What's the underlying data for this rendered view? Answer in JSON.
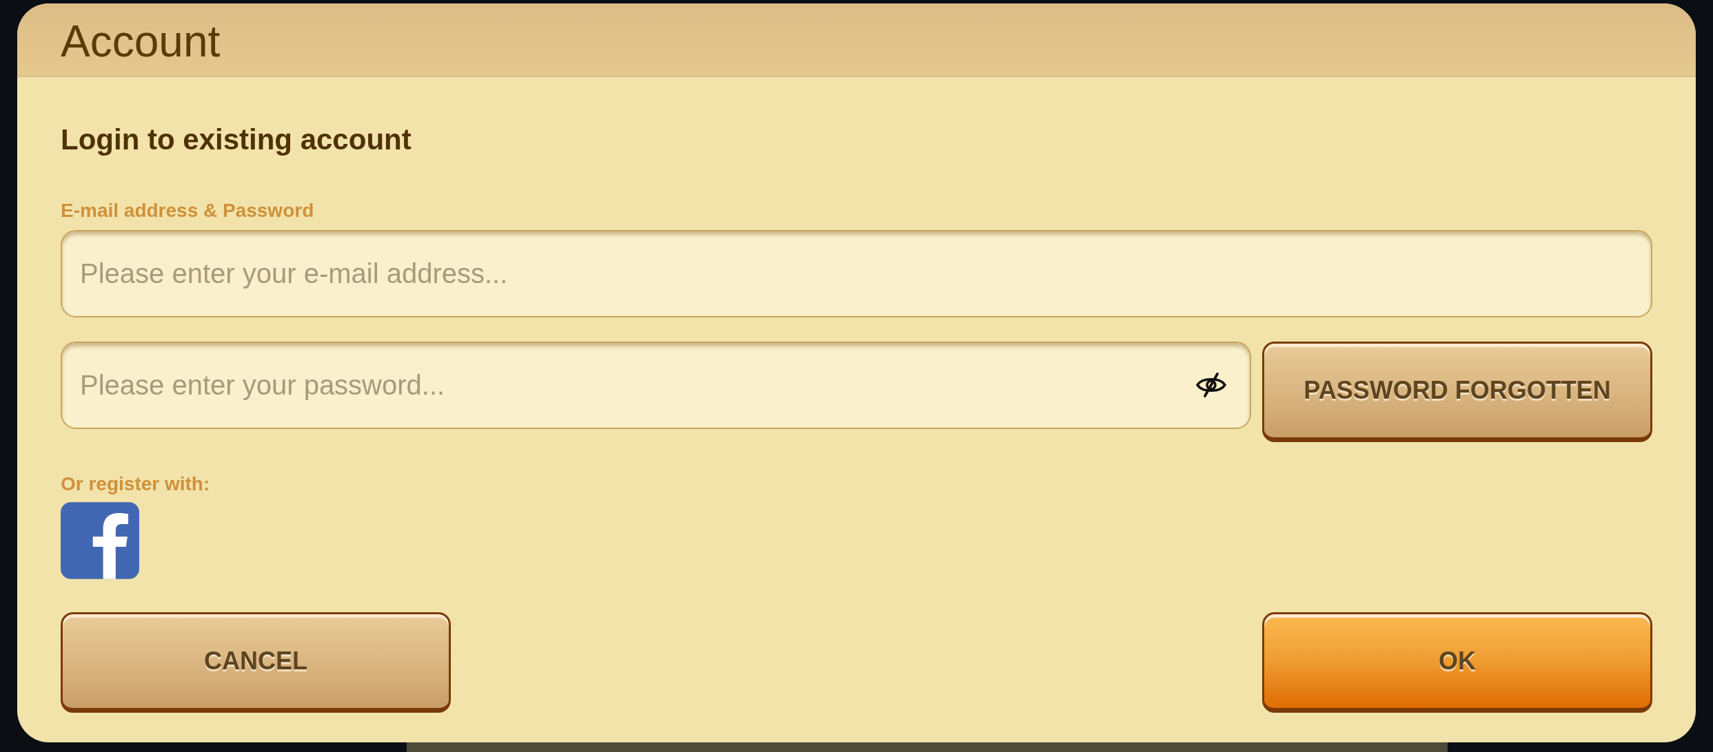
{
  "window": {
    "title": "Account"
  },
  "login": {
    "heading": "Login to existing account",
    "credentials_label": "E-mail address & Password",
    "email_field": {
      "placeholder": "Please enter your e-mail address..."
    },
    "password_field": {
      "placeholder": "Please enter your password...",
      "password_visible": false
    },
    "forgot_button": {
      "label": "PASSWORD FORGOTTEN"
    }
  },
  "register": {
    "label": "Or register with:"
  },
  "actions": [
    {
      "label": "CANCEL",
      "kind": "secondary"
    },
    {
      "label": "OK",
      "kind": "primary"
    }
  ]
}
